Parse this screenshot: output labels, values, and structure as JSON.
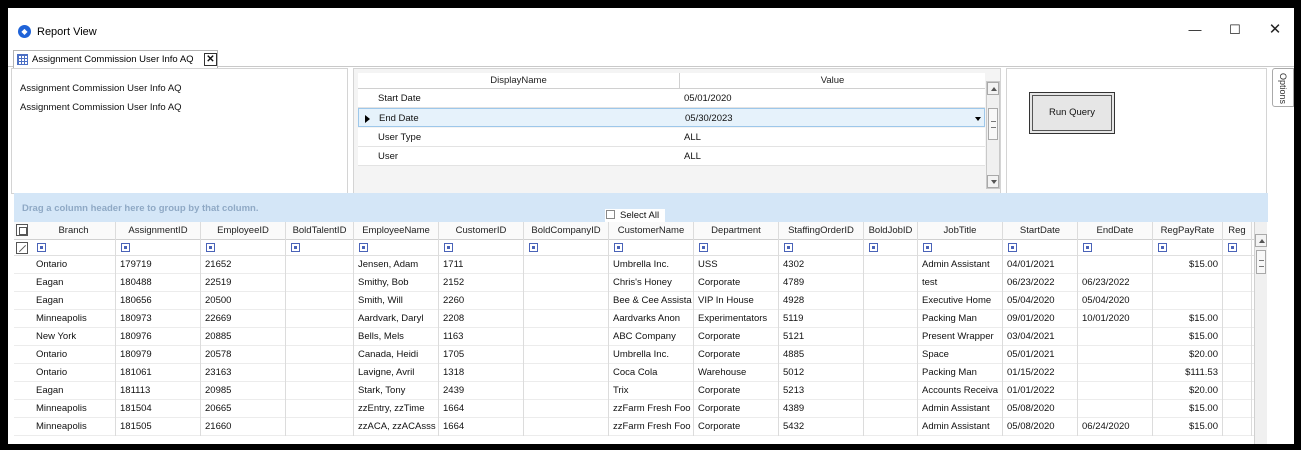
{
  "window": {
    "title": "Report View",
    "icon": "app-logo-icon",
    "controls": {
      "minimize": "—",
      "maximize": "☐",
      "close": "✕"
    }
  },
  "tab": {
    "label": "Assignment Commission User Info AQ",
    "close": "✕",
    "icon": "grid-icon"
  },
  "report_info": {
    "lines": [
      "Assignment Commission User Info AQ",
      "Assignment Commission User Info AQ"
    ]
  },
  "parameters": {
    "headers": {
      "display_name": "DisplayName",
      "value": "Value"
    },
    "rows": [
      {
        "name": "Start Date",
        "value": "05/01/2020"
      },
      {
        "name": "End Date",
        "value": "05/30/2023"
      },
      {
        "name": "User Type",
        "value": "ALL"
      },
      {
        "name": "User",
        "value": "ALL"
      }
    ]
  },
  "query": {
    "run_label": "Run Query"
  },
  "options_tab": {
    "label": "Options"
  },
  "grid": {
    "group_hint": "Drag a column header here to group by that column.",
    "select_all": "Select All",
    "columns": [
      "Branch",
      "AssignmentID",
      "EmployeeID",
      "BoldTalentID",
      "EmployeeName",
      "CustomerID",
      "BoldCompanyID",
      "CustomerName",
      "Department",
      "StaffingOrderID",
      "BoldJobID",
      "JobTitle",
      "StartDate",
      "EndDate",
      "RegPayRate",
      "Reg"
    ],
    "rows": [
      [
        "Ontario",
        "179719",
        "21652",
        "",
        "Jensen, Adam",
        "1711",
        "",
        "Umbrella Inc.",
        "USS",
        "4302",
        "",
        "Admin Assistant",
        "04/01/2021",
        "",
        "$15.00",
        ""
      ],
      [
        "Eagan",
        "180488",
        "22519",
        "",
        "Smithy, Bob",
        "2152",
        "",
        "Chris's Honey",
        "Corporate",
        "4789",
        "",
        "test",
        "06/23/2022",
        "06/23/2022",
        "",
        ""
      ],
      [
        "Eagan",
        "180656",
        "20500",
        "",
        "Smith, Will",
        "2260",
        "",
        "Bee & Cee Assista",
        "VIP In House",
        "4928",
        "",
        "Executive Home",
        "05/04/2020",
        "05/04/2020",
        "",
        ""
      ],
      [
        "Minneapolis",
        "180973",
        "22669",
        "",
        "Aardvark, Daryl",
        "2208",
        "",
        "Aardvarks Anon",
        "Experimentators",
        "5119",
        "",
        "Packing Man",
        "09/01/2020",
        "10/01/2020",
        "$15.00",
        ""
      ],
      [
        "New York",
        "180976",
        "20885",
        "",
        "Bells, Mels",
        "1163",
        "",
        "ABC Company",
        "Corporate",
        "5121",
        "",
        "Present Wrapper",
        "03/04/2021",
        "",
        "$15.00",
        ""
      ],
      [
        "Ontario",
        "180979",
        "20578",
        "",
        "Canada, Heidi",
        "1705",
        "",
        "Umbrella Inc.",
        "Corporate",
        "4885",
        "",
        "Space",
        "05/01/2021",
        "",
        "$20.00",
        ""
      ],
      [
        "Ontario",
        "181061",
        "23163",
        "",
        "Lavigne, Avril",
        "1318",
        "",
        "Coca Cola",
        "Warehouse",
        "5012",
        "",
        "Packing Man",
        "01/15/2022",
        "",
        "$111.53",
        ""
      ],
      [
        "Eagan",
        "181113",
        "20985",
        "",
        "Stark, Tony",
        "2439",
        "",
        "Trix",
        "Corporate",
        "5213",
        "",
        "Accounts Receiva",
        "01/01/2022",
        "",
        "$20.00",
        ""
      ],
      [
        "Minneapolis",
        "181504",
        "20665",
        "",
        "zzEntry, zzTime",
        "1664",
        "",
        "zzFarm Fresh Foo",
        "Corporate",
        "4389",
        "",
        "Admin Assistant",
        "05/08/2020",
        "",
        "$15.00",
        ""
      ],
      [
        "Minneapolis",
        "181505",
        "21660",
        "",
        "zzACA, zzACAsss",
        "1664",
        "",
        "zzFarm Fresh Foo",
        "Corporate",
        "5432",
        "",
        "Admin Assistant",
        "05/08/2020",
        "06/24/2020",
        "$15.00",
        ""
      ]
    ]
  }
}
